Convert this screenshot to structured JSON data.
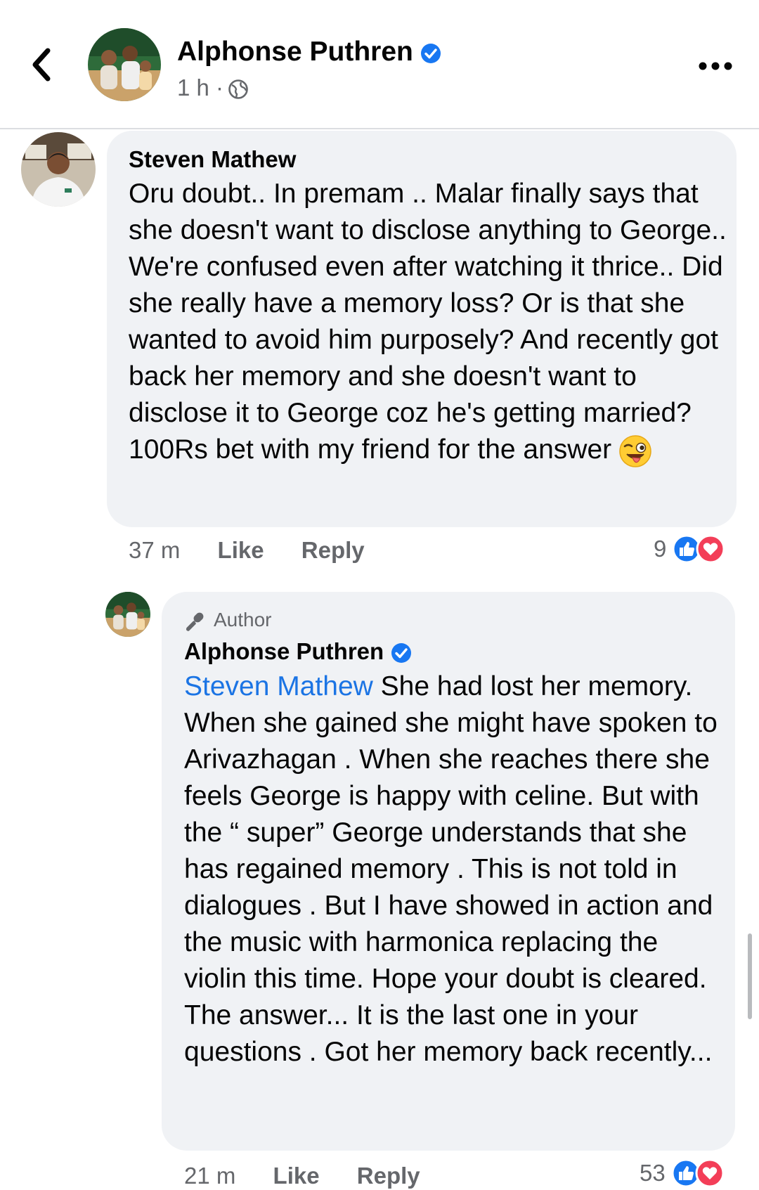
{
  "header": {
    "back_icon": "chevron-left-icon",
    "page_name": "Alphonse Puthren",
    "verified_icon": "verified-badge-icon",
    "time": "1 h ·",
    "audience_icon": "globe-icon",
    "more_icon": "more-horizontal-icon"
  },
  "comments": [
    {
      "author": "Steven Mathew",
      "text": "Oru doubt.. In premam .. Malar finally says that she doesn't want to disclose anything to George.. We're confused even after watching it thrice.. Did she really have a memory loss? Or is that she wanted to avoid him purposely? And recently got back her memory and she doesn't want to disclose it to George coz he's getting married? 100Rs bet with my friend for the answer",
      "emoji": "winking-face-with-tongue",
      "time": "37 m",
      "like_label": "Like",
      "reply_label": "Reply",
      "reaction_count": "9",
      "reactions": [
        "like",
        "love"
      ]
    },
    {
      "label": "Author",
      "author": "Alphonse Puthren",
      "mention": "Steven Mathew",
      "text": " She had lost her memory. When she gained she might have spoken to Arivazhagan . When she reaches there she feels George is happy with celine. But with the “ super” George understands that she has regained memory . This is not told in dialogues . But I have showed in action and the music with harmonica replacing the violin this time. Hope your doubt is cleared. The answer... It is the last one in your questions . Got her memory back recently...",
      "time": "21 m",
      "like_label": "Like",
      "reply_label": "Reply",
      "reaction_count": "53",
      "reactions": [
        "like",
        "love"
      ]
    }
  ],
  "colors": {
    "link": "#1b74e4",
    "verified": "#1877f2",
    "like": "#1877f2",
    "love": "#f33e58",
    "bubble": "#f0f2f5",
    "secondary_text": "#65676b"
  }
}
